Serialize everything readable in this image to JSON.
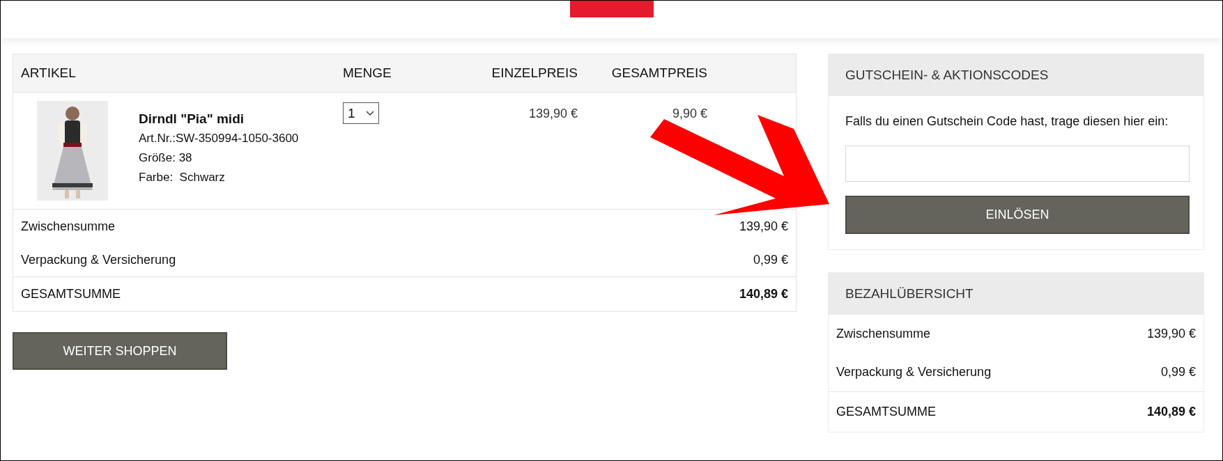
{
  "cart": {
    "columns": [
      "ARTIKEL",
      "MENGE",
      "EINZELPREIS",
      "GESAMTPREIS"
    ],
    "items": [
      {
        "name": "Dirndl \"Pia\" midi",
        "article_number": "Art.Nr.:SW-350994-1050-3600",
        "size_label": "Größe:",
        "size": "38",
        "color_label": "Farbe:",
        "color_value": "Schwarz",
        "quantity": "1",
        "unit_price": "139,90 €",
        "total_price": "9,90 €"
      }
    ],
    "summary": [
      {
        "label": "Zwischensumme",
        "value": "139,90 €",
        "kind": "line"
      },
      {
        "label": "Verpackung & Versicherung",
        "value": "0,99 €",
        "kind": "line"
      },
      {
        "label": "GESAMTSUMME",
        "value": "140,89 €",
        "kind": "total"
      }
    ]
  },
  "continue_button": "WEITER SHOPPEN",
  "voucher": {
    "title": "GUTSCHEIN- & AKTIONSCODES",
    "text": "Falls du einen Gutschein Code hast, trage diesen hier ein:",
    "button": "EINLÖSEN"
  },
  "payment_overview": {
    "title": "BEZAHLÜBERSICHT",
    "rows": [
      {
        "label": "Zwischensumme",
        "value": "139,90 €",
        "kind": "line"
      },
      {
        "label": "Verpackung & Versicherung",
        "value": "0,99 €",
        "kind": "line"
      },
      {
        "label": "GESAMTSUMME",
        "value": "140,89 €",
        "kind": "total"
      }
    ]
  }
}
